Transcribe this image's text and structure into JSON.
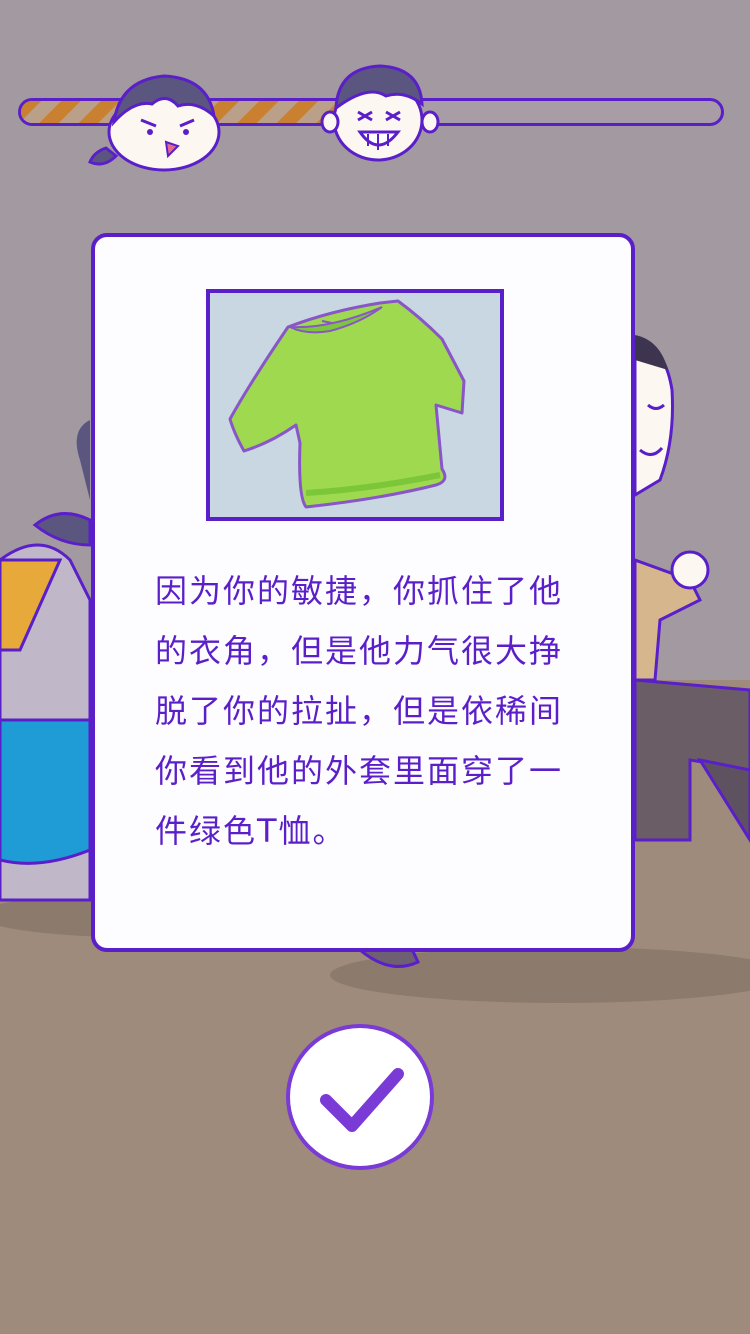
{
  "progress": {
    "fraction": 0.45,
    "fill_color": "#c98030",
    "border_color": "#5a1fc9"
  },
  "avatars": {
    "player": "girl-face-icon",
    "suspect": "laughing-boy-face-icon"
  },
  "dialog": {
    "image": "green-tshirt-icon",
    "text": "因为你的敏捷，你抓住了他的衣角，但是他力气很大挣脱了你的拉扯，但是依稀间你看到他的外套里面穿了一件绿色T恤。"
  },
  "confirm_button": {
    "icon": "check-icon",
    "color": "#7a3ad6"
  },
  "colors": {
    "accent": "#5a1fc9",
    "shirt": "#9ed94f",
    "background": "#9c8b7c"
  }
}
